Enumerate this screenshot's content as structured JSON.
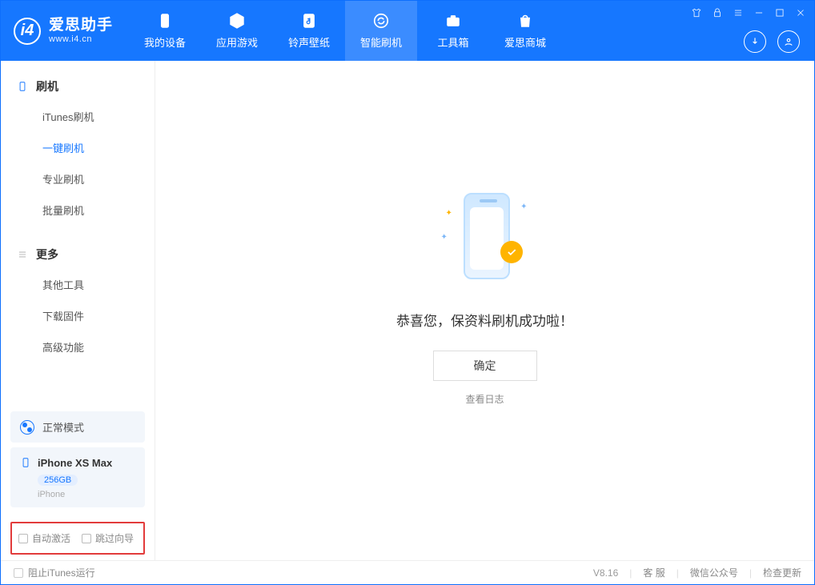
{
  "app": {
    "name_cn": "爱思助手",
    "name_en": "www.i4.cn"
  },
  "nav": {
    "items": [
      {
        "label": "我的设备"
      },
      {
        "label": "应用游戏"
      },
      {
        "label": "铃声壁纸"
      },
      {
        "label": "智能刷机"
      },
      {
        "label": "工具箱"
      },
      {
        "label": "爱思商城"
      }
    ]
  },
  "sidebar": {
    "group_flash": "刷机",
    "items_flash": [
      {
        "label": "iTunes刷机"
      },
      {
        "label": "一键刷机"
      },
      {
        "label": "专业刷机"
      },
      {
        "label": "批量刷机"
      }
    ],
    "group_more": "更多",
    "items_more": [
      {
        "label": "其他工具"
      },
      {
        "label": "下载固件"
      },
      {
        "label": "高级功能"
      }
    ],
    "mode": "正常模式",
    "device": {
      "name": "iPhone XS Max",
      "capacity": "256GB",
      "type": "iPhone"
    },
    "opts": {
      "auto_activate": "自动激活",
      "skip_guide": "跳过向导"
    }
  },
  "main": {
    "success_msg": "恭喜您，保资料刷机成功啦！",
    "ok": "确定",
    "view_log": "查看日志"
  },
  "footer": {
    "block_itunes": "阻止iTunes运行",
    "version": "V8.16",
    "support": "客 服",
    "wechat": "微信公众号",
    "update": "检查更新"
  }
}
